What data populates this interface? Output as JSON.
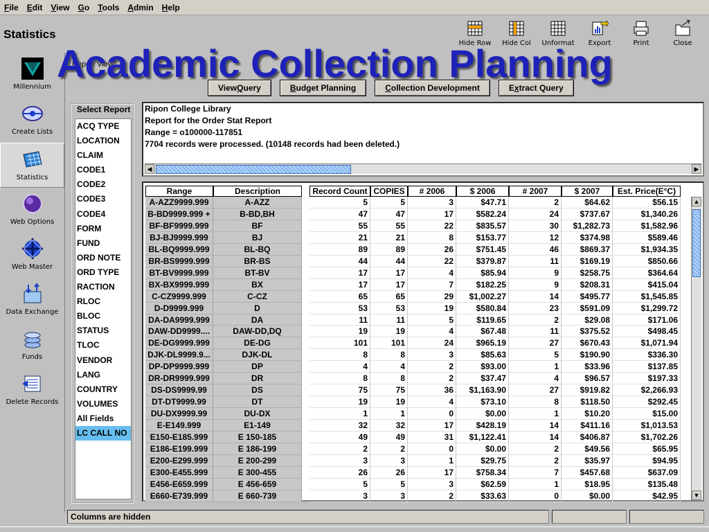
{
  "menu": [
    "File",
    "Edit",
    "View",
    "Go",
    "Tools",
    "Admin",
    "Help"
  ],
  "menu_underline": [
    "F",
    "E",
    "V",
    "G",
    "T",
    "A",
    "H"
  ],
  "app_title": "Statistics",
  "overlay_title": "Academic Collection Planning",
  "report_view_label": "Report View",
  "toolbar": [
    {
      "label": "Hide Row",
      "icon": "hide-row-icon"
    },
    {
      "label": "Hide Col",
      "icon": "hide-col-icon"
    },
    {
      "label": "Unformat",
      "icon": "unformat-icon"
    },
    {
      "label": "Export",
      "icon": "export-icon"
    },
    {
      "label": "Print",
      "icon": "print-icon"
    },
    {
      "label": "Close",
      "icon": "close-icon"
    }
  ],
  "sidebar": [
    {
      "label": "Millennium",
      "icon": "millennium-icon"
    },
    {
      "label": "Create Lists",
      "icon": "create-lists-icon"
    },
    {
      "label": "Statistics",
      "icon": "statistics-icon"
    },
    {
      "label": "Web Options",
      "icon": "web-options-icon"
    },
    {
      "label": "Web Master",
      "icon": "web-master-icon"
    },
    {
      "label": "Data Exchange",
      "icon": "data-exchange-icon"
    },
    {
      "label": "Funds",
      "icon": "funds-icon"
    },
    {
      "label": "Delete Records",
      "icon": "delete-records-icon"
    }
  ],
  "sidebar_active": "Statistics",
  "subtabs": [
    "View Query",
    "Budget Planning",
    "Collection Development",
    "Extract Query"
  ],
  "subtab_underline": [
    "Q",
    "B",
    "C",
    "x"
  ],
  "select_report_title": "Select Report",
  "report_list": [
    "ACQ TYPE",
    "LOCATION",
    "CLAIM",
    "CODE1",
    "CODE2",
    "CODE3",
    "CODE4",
    "FORM",
    "FUND",
    "ORD NOTE",
    "ORD TYPE",
    "RACTION",
    "RLOC",
    "BLOC",
    "STATUS",
    "TLOC",
    "VENDOR",
    "LANG",
    "COUNTRY",
    "VOLUMES",
    "All Fields",
    "LC CALL NO"
  ],
  "report_selected": "LC CALL NO",
  "report_header": [
    "Ripon College Library",
    "Report for the Order Stat Report",
    "Range = o100000-117851",
    "7704 records were processed.  (10148 records had been deleted.)"
  ],
  "left_columns": [
    "Range",
    "Description"
  ],
  "right_columns": [
    "Record Count",
    "COPIES",
    "# 2006",
    "$ 2006",
    "# 2007",
    "$ 2007",
    "Est. Price(E°C)"
  ],
  "rows": [
    [
      "A-AZZ9999.999",
      "A-AZZ",
      "5",
      "5",
      "3",
      "$47.71",
      "2",
      "$64.62",
      "$56.15"
    ],
    [
      "B-BD9999.999 +",
      "B-BD,BH",
      "47",
      "47",
      "17",
      "$582.24",
      "24",
      "$737.67",
      "$1,340.26"
    ],
    [
      "BF-BF9999.999",
      "BF",
      "55",
      "55",
      "22",
      "$835.57",
      "30",
      "$1,282.73",
      "$1,582.96"
    ],
    [
      "BJ-BJ9999.999",
      "BJ",
      "21",
      "21",
      "8",
      "$153.77",
      "12",
      "$374.98",
      "$589.46"
    ],
    [
      "BL-BQ9999.999",
      "BL-BQ",
      "89",
      "89",
      "26",
      "$751.45",
      "46",
      "$869.37",
      "$1,934.35"
    ],
    [
      "BR-BS9999.999",
      "BR-BS",
      "44",
      "44",
      "22",
      "$379.87",
      "11",
      "$169.19",
      "$850.66"
    ],
    [
      "BT-BV9999.999",
      "BT-BV",
      "17",
      "17",
      "4",
      "$85.94",
      "9",
      "$258.75",
      "$364.64"
    ],
    [
      "BX-BX9999.999",
      "BX",
      "17",
      "17",
      "7",
      "$182.25",
      "9",
      "$208.31",
      "$415.04"
    ],
    [
      "C-CZ9999.999",
      "C-CZ",
      "65",
      "65",
      "29",
      "$1,002.27",
      "14",
      "$495.77",
      "$1,545.85"
    ],
    [
      "D-D9999.999",
      "D",
      "53",
      "53",
      "19",
      "$580.84",
      "23",
      "$591.09",
      "$1,299.72"
    ],
    [
      "DA-DA9999.999",
      "DA",
      "11",
      "11",
      "5",
      "$119.65",
      "2",
      "$29.08",
      "$171.06"
    ],
    [
      "DAW-DD9999....",
      "DAW-DD,DQ",
      "19",
      "19",
      "4",
      "$67.48",
      "11",
      "$375.52",
      "$498.45"
    ],
    [
      "DE-DG9999.999",
      "DE-DG",
      "101",
      "101",
      "24",
      "$965.19",
      "27",
      "$670.43",
      "$1,071.94"
    ],
    [
      "DJK-DL9999.9...",
      "DJK-DL",
      "8",
      "8",
      "3",
      "$85.63",
      "5",
      "$190.90",
      "$336.30"
    ],
    [
      "DP-DP9999.999",
      "DP",
      "4",
      "4",
      "2",
      "$93.00",
      "1",
      "$33.96",
      "$137.85"
    ],
    [
      "DR-DR9999.999",
      "DR",
      "8",
      "8",
      "2",
      "$37.47",
      "4",
      "$96.57",
      "$197.33"
    ],
    [
      "DS-DS9999.99",
      "DS",
      "75",
      "75",
      "36",
      "$1,163.90",
      "27",
      "$919.82",
      "$2,266.93"
    ],
    [
      "DT-DT9999.99",
      "DT",
      "19",
      "19",
      "4",
      "$73.10",
      "8",
      "$118.50",
      "$292.45"
    ],
    [
      "DU-DX9999.99",
      "DU-DX",
      "1",
      "1",
      "0",
      "$0.00",
      "1",
      "$10.20",
      "$15.00"
    ],
    [
      "E-E149.999",
      "E1-149",
      "32",
      "32",
      "17",
      "$428.19",
      "14",
      "$411.16",
      "$1,013.53"
    ],
    [
      "E150-E185.999",
      "E 150-185",
      "49",
      "49",
      "31",
      "$1,122.41",
      "14",
      "$406.87",
      "$1,702.26"
    ],
    [
      "E186-E199.999",
      "E 186-199",
      "2",
      "2",
      "0",
      "$0.00",
      "2",
      "$49.56",
      "$65.95"
    ],
    [
      "E200-E299.999",
      "E 200-299",
      "3",
      "3",
      "1",
      "$29.75",
      "2",
      "$35.97",
      "$94.95"
    ],
    [
      "E300-E455.999",
      "E 300-455",
      "26",
      "26",
      "17",
      "$758.34",
      "7",
      "$457.68",
      "$637.09"
    ],
    [
      "E456-E659.999",
      "E 456-659",
      "5",
      "5",
      "3",
      "$62.59",
      "1",
      "$18.95",
      "$135.48"
    ],
    [
      "E660-E739.999",
      "E 660-739",
      "3",
      "3",
      "2",
      "$33.63",
      "0",
      "$0.00",
      "$42.95"
    ]
  ],
  "status_text": "Columns are hidden"
}
